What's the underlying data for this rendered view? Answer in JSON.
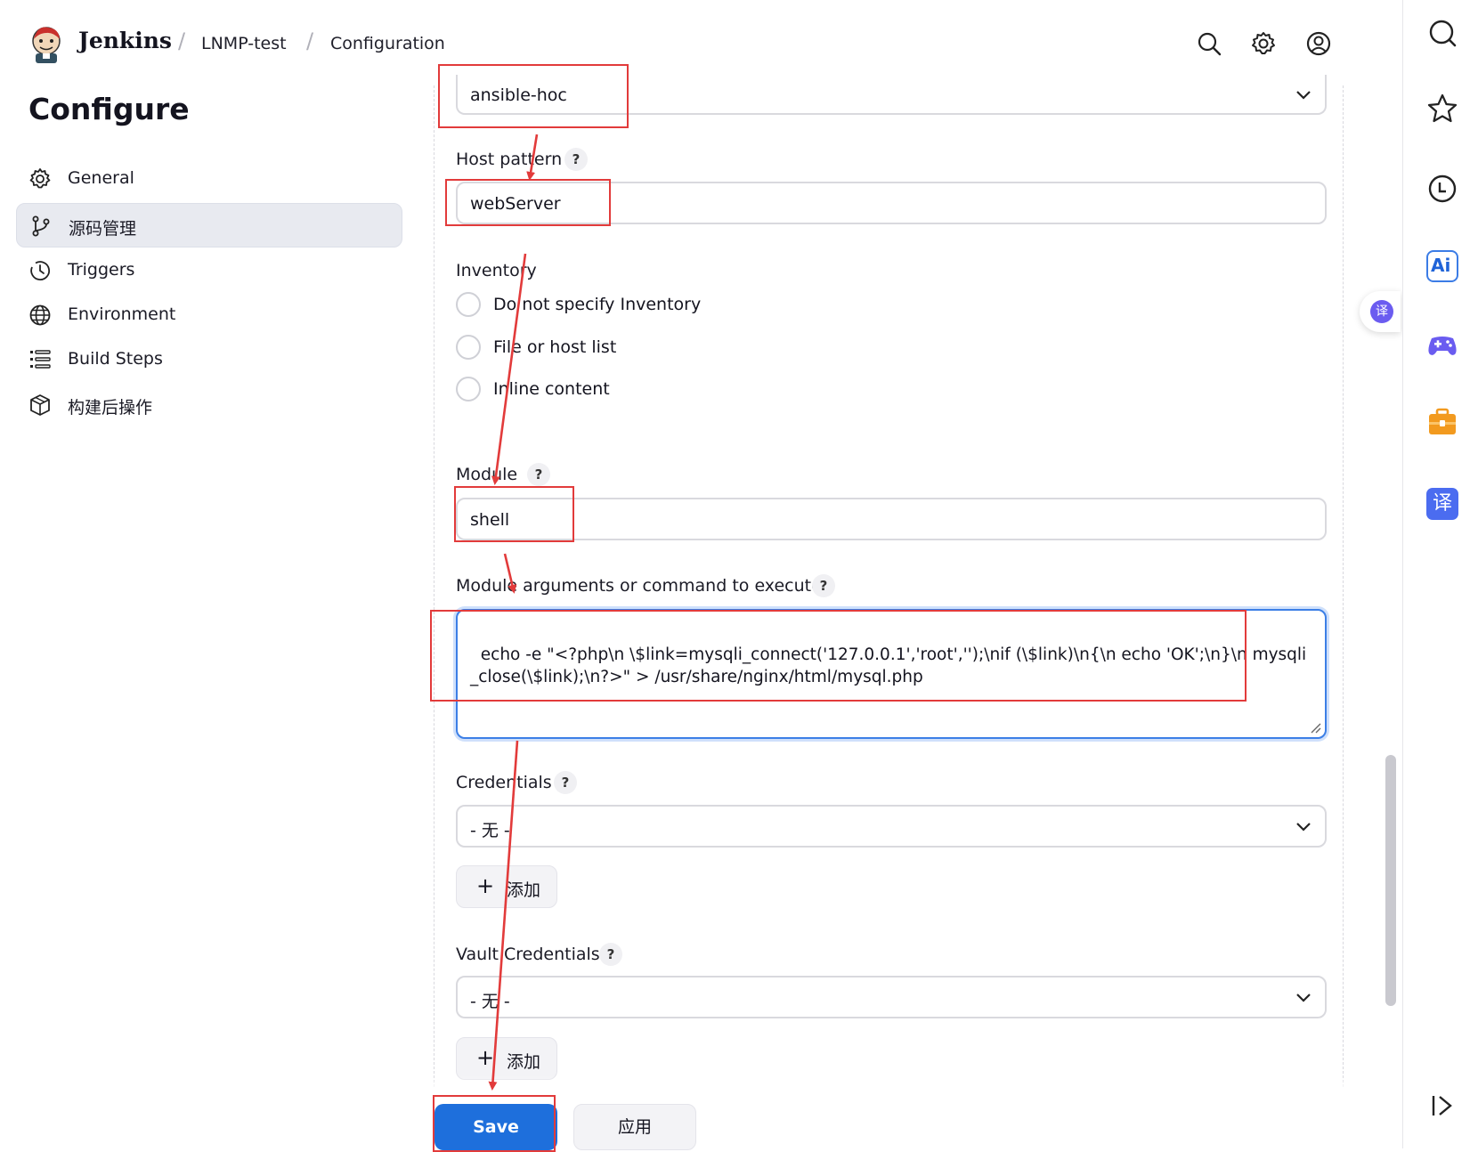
{
  "header": {
    "brand": "Jenkins",
    "breadcrumb": [
      "LNMP-test",
      "Configuration"
    ],
    "icons": [
      "search-icon",
      "gear-icon",
      "user-icon"
    ]
  },
  "sidebar": {
    "title": "Configure",
    "items": [
      {
        "label": "General",
        "icon": "gear-icon",
        "active": false
      },
      {
        "label": "源码管理",
        "icon": "git-branch-icon",
        "active": true
      },
      {
        "label": "Triggers",
        "icon": "clock-icon",
        "active": false
      },
      {
        "label": "Environment",
        "icon": "globe-icon",
        "active": false
      },
      {
        "label": "Build Steps",
        "icon": "list-icon",
        "active": false
      },
      {
        "label": "构建后操作",
        "icon": "cube-icon",
        "active": false
      }
    ]
  },
  "form": {
    "installation": {
      "value": "ansible-hoc"
    },
    "host_pattern": {
      "label": "Host pattern",
      "help": "?",
      "value": "webServer"
    },
    "inventory": {
      "label": "Inventory",
      "options": [
        "Do not specify Inventory",
        "File or host list",
        "Inline content"
      ]
    },
    "module": {
      "label": "Module",
      "help": "?",
      "value": "shell"
    },
    "module_args": {
      "label": "Module arguments or command to execute",
      "help": "?",
      "value": "echo -e \"<?php\\n \\$link=mysqli_connect('127.0.0.1','root','');\\nif (\\$link)\\n{\\n echo 'OK';\\n}\\n mysqli_close(\\$link);\\n?>\" > /usr/share/nginx/html/mysql.php"
    },
    "credentials": {
      "label": "Credentials",
      "help": "?",
      "value": "- 无 -",
      "add_label": "添加"
    },
    "vault_credentials": {
      "label": "Vault Credentials",
      "help": "?",
      "value": "- 无 -",
      "add_label": "添加"
    }
  },
  "footer": {
    "save_label": "Save",
    "apply_label": "应用"
  },
  "right_toolbar": {
    "icons": [
      "search-icon",
      "star-icon",
      "history-icon",
      "ai-icon",
      "gamepad-icon",
      "toolbox-icon",
      "translate-icon",
      "collapse-panel-icon"
    ],
    "floating_translate_label": "译",
    "ai_label": "Ai",
    "translate_label": "译"
  },
  "colors": {
    "primary": "#1e6fdc",
    "annotation": "#e23b3b",
    "focus": "#3c7fe6"
  }
}
